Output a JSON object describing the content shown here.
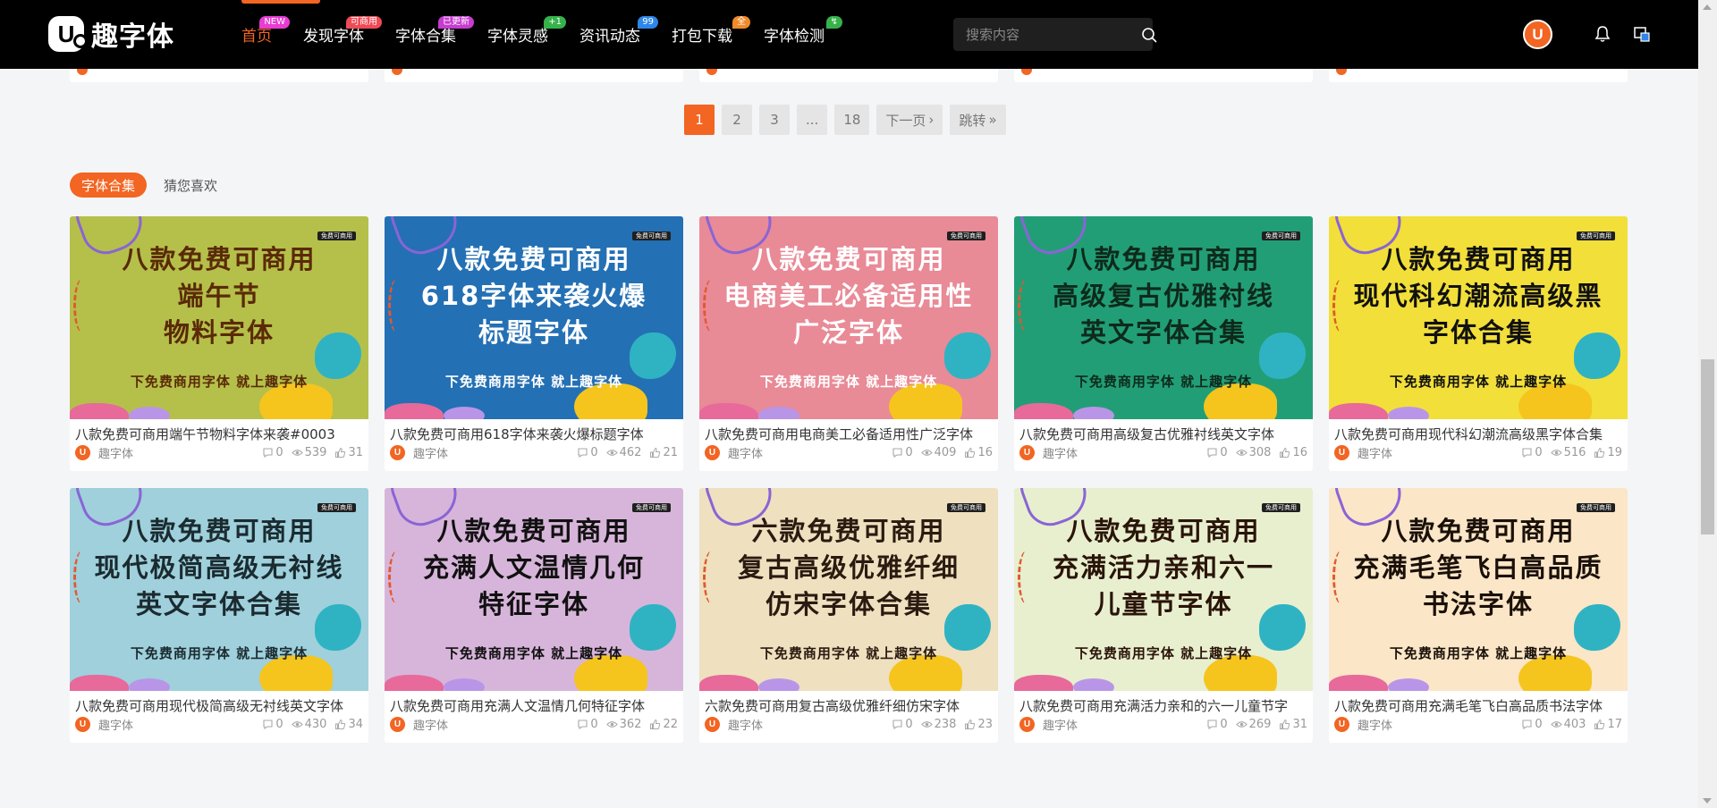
{
  "header": {
    "logo_mark": "U",
    "logo_text": "趣字体",
    "nav": [
      {
        "label": "首页",
        "badge": "NEW",
        "badge_color": "#e83cd2",
        "active": true
      },
      {
        "label": "发现字体",
        "badge": "可商用",
        "badge_color": "#ef4b56",
        "active": false
      },
      {
        "label": "字体合集",
        "badge": "已更新",
        "badge_color": "#c53ccf",
        "active": false
      },
      {
        "label": "字体灵感",
        "badge": "+1",
        "badge_color": "#36b24a",
        "active": false
      },
      {
        "label": "资讯动态",
        "badge": "99",
        "badge_color": "#2f86e8",
        "active": false
      },
      {
        "label": "打包下载",
        "badge": "全",
        "badge_color": "#f08a2a",
        "active": false
      },
      {
        "label": "字体检测",
        "badge": "↯",
        "badge_color": "#36b24a",
        "active": false
      }
    ],
    "search_placeholder": "搜索内容",
    "user_avatar": "U"
  },
  "pagination": {
    "pages": [
      "1",
      "2",
      "3",
      "...",
      "18"
    ],
    "current": "1",
    "next_label": "下一页",
    "jump_label": "跳转"
  },
  "tabs": [
    {
      "label": "字体合集",
      "active": true
    },
    {
      "label": "猜您喜欢",
      "active": false
    }
  ],
  "colors": {
    "accent": "#f26522",
    "header_bg": "#000000",
    "page_bg": "#f4f5f7"
  },
  "cards": [
    {
      "title": "八款免费可商用端午节物料字体来袭#0003",
      "author": "趣字体",
      "comments": "0",
      "views": "539",
      "likes": "31",
      "thumb": {
        "bg": "#b5c04a",
        "ink": "#5a2a08",
        "lines": [
          "八款免费可商用",
          "端午节",
          "物料字体"
        ],
        "sub": "下免费商用字体 就上趣字体",
        "ribbon": "免费可商用"
      }
    },
    {
      "title": "八款免费可商用618字体来袭火爆标题字体",
      "author": "趣字体",
      "comments": "0",
      "views": "462",
      "likes": "21",
      "thumb": {
        "bg": "#2470b4",
        "ink": "#ffffff",
        "lines": [
          "八款免费可商用",
          "618字体来袭火爆",
          "标题字体"
        ],
        "sub": "下免费商用字体 就上趣字体",
        "ribbon": "免费可商用"
      }
    },
    {
      "title": "八款免费可商用电商美工必备适用性广泛字体",
      "author": "趣字体",
      "comments": "0",
      "views": "409",
      "likes": "16",
      "thumb": {
        "bg": "#e98a97",
        "ink": "#ffffff",
        "lines": [
          "八款免费可商用",
          "电商美工必备适用性",
          "广泛字体"
        ],
        "sub": "下免费商用字体 就上趣字体",
        "ribbon": "免费可商用"
      }
    },
    {
      "title": "八款免费可商用高级复古优雅衬线英文字体",
      "author": "趣字体",
      "comments": "0",
      "views": "308",
      "likes": "16",
      "thumb": {
        "bg": "#229e76",
        "ink": "#0e2a1c",
        "lines": [
          "八款免费可商用",
          "高级复古优雅衬线",
          "英文字体合集"
        ],
        "sub": "下免费商用字体 就上趣字体",
        "ribbon": "免费可商用"
      }
    },
    {
      "title": "八款免费可商用现代科幻潮流高级黑字体合集",
      "author": "趣字体",
      "comments": "0",
      "views": "516",
      "likes": "19",
      "thumb": {
        "bg": "#f2df3a",
        "ink": "#111111",
        "lines": [
          "八款免费可商用",
          "现代科幻潮流高级黑",
          "字体合集"
        ],
        "sub": "下免费商用字体 就上趣字体",
        "ribbon": "免费可商用"
      }
    },
    {
      "title": "八款免费可商用现代极简高级无衬线英文字体",
      "author": "趣字体",
      "comments": "0",
      "views": "430",
      "likes": "34",
      "thumb": {
        "bg": "#9fd0dc",
        "ink": "#1b2b30",
        "lines": [
          "八款免费可商用",
          "现代极简高级无衬线",
          "英文字体合集"
        ],
        "sub": "下免费商用字体 就上趣字体",
        "ribbon": "免费可商用"
      }
    },
    {
      "title": "八款免费可商用充满人文温情几何特征字体",
      "author": "趣字体",
      "comments": "0",
      "views": "362",
      "likes": "22",
      "thumb": {
        "bg": "#d7b5da",
        "ink": "#111111",
        "lines": [
          "八款免费可商用",
          "充满人文温情几何",
          "特征字体"
        ],
        "sub": "下免费商用字体 就上趣字体",
        "ribbon": "免费可商用"
      }
    },
    {
      "title": "六款免费可商用复古高级优雅纤细仿宋字体",
      "author": "趣字体",
      "comments": "0",
      "views": "238",
      "likes": "23",
      "thumb": {
        "bg": "#efe0bf",
        "ink": "#2a1a10",
        "lines": [
          "六款免费可商用",
          "复古高级优雅纤细",
          "仿宋字体合集"
        ],
        "sub": "下免费商用字体 就上趣字体",
        "ribbon": "免费可商用"
      }
    },
    {
      "title": "八款免费可商用充满活力亲和的六一儿童节字",
      "author": "趣字体",
      "comments": "0",
      "views": "269",
      "likes": "31",
      "thumb": {
        "bg": "#e8efcf",
        "ink": "#2a1408",
        "lines": [
          "八款免费可商用",
          "充满活力亲和六一",
          "儿童节字体"
        ],
        "sub": "下免费商用字体 就上趣字体",
        "ribbon": "免费可商用"
      }
    },
    {
      "title": "八款免费可商用充满毛笔飞白高品质书法字体",
      "author": "趣字体",
      "comments": "0",
      "views": "403",
      "likes": "17",
      "thumb": {
        "bg": "#fbe6c8",
        "ink": "#1a1008",
        "lines": [
          "八款免费可商用",
          "充满毛笔飞白高品质",
          "书法字体"
        ],
        "sub": "下免费商用字体 就上趣字体",
        "ribbon": "免费可商用"
      }
    }
  ]
}
